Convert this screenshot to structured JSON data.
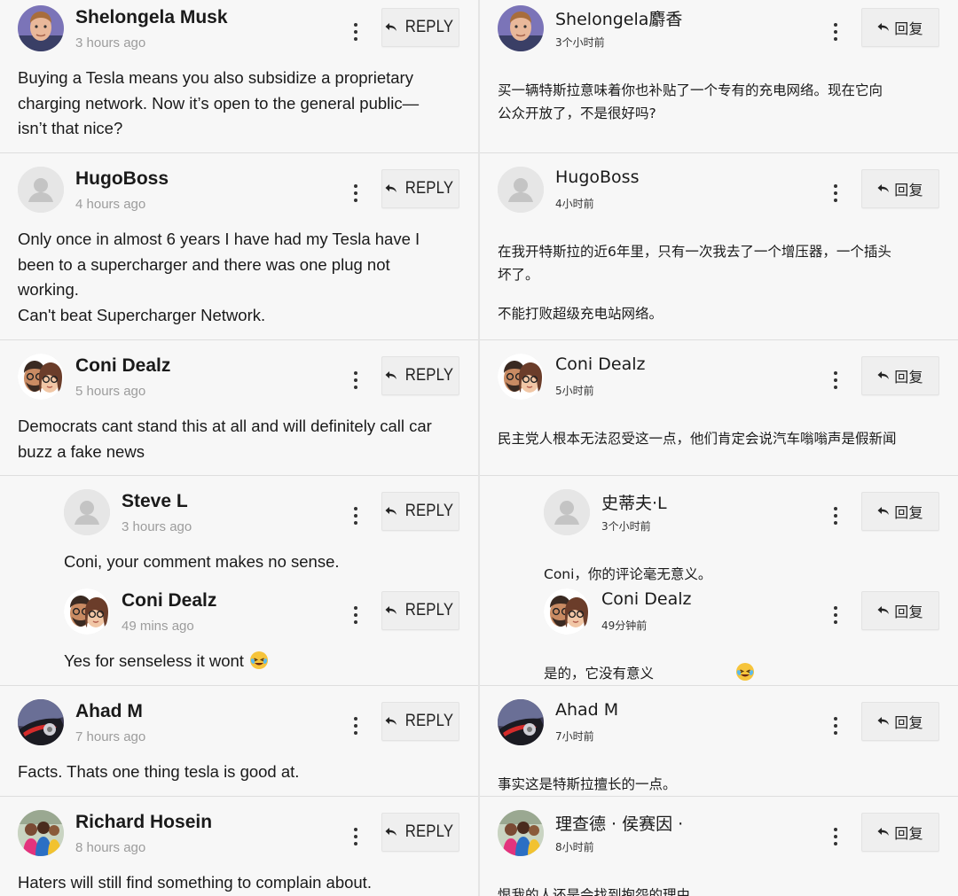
{
  "left": {
    "reply_label": "REPLY",
    "comments": [
      {
        "name": "Shelongela Musk",
        "time": "3 hours ago",
        "lines": [
          "Buying a Tesla means you also subsidize a proprietary",
          "charging network. Now it’s open to the general public—",
          "isn’t that nice?"
        ]
      },
      {
        "name": "HugoBoss",
        "time": "4 hours ago",
        "lines": [
          "Only once in almost 6 years I have had my Tesla have I",
          "been to a supercharger and there was one plug not",
          "working.",
          "Can't beat Supercharger Network."
        ]
      },
      {
        "name": "Coni Dealz",
        "time": "5 hours ago",
        "lines": [
          "Democrats cant stand this at all and will definitely call car",
          "buzz a fake news"
        ]
      },
      {
        "name": "Steve L",
        "time": "3 hours ago",
        "lines": [
          "Coni, your comment makes no sense."
        ]
      },
      {
        "name": "Coni Dealz",
        "time": "49 mins ago",
        "lines": [
          "Yes for senseless it wont"
        ]
      },
      {
        "name": "Ahad M",
        "time": "7 hours ago",
        "lines": [
          "Facts. Thats one thing tesla is good at."
        ]
      },
      {
        "name": "Richard Hosein",
        "time": "8 hours ago",
        "lines": [
          "Haters will still find something to complain about."
        ]
      }
    ]
  },
  "right": {
    "reply_label": "回复",
    "comments": [
      {
        "name": "Shelongela麝香",
        "time": "3个小时前",
        "lines": [
          "买一辆特斯拉意味着你也补贴了一个专有的充电网络。现在它向",
          "公众开放了，不是很好吗?"
        ]
      },
      {
        "name": "HugoBoss",
        "time": "4小时前",
        "lines": [
          "在我开特斯拉的近6年里，只有一次我去了一个增压器，一个插头",
          "坏了。",
          "不能打败超级充电站网络。"
        ]
      },
      {
        "name": "Coni Dealz",
        "time": "5小时前",
        "lines": [
          "民主党人根本无法忍受这一点，他们肯定会说汽车嗡嗡声是假新闻"
        ]
      },
      {
        "name": "史蒂夫·L",
        "time": "3个小时前",
        "lines": [
          "Coni，你的评论毫无意义。"
        ]
      },
      {
        "name": "Coni Dealz",
        "time": "49分钟前",
        "lines": [
          "是的，它没有意义"
        ]
      },
      {
        "name": "Ahad M",
        "time": "7小时前",
        "lines": [
          "事实这是特斯拉擅长的一点。"
        ]
      },
      {
        "name": "理查德 · 侯赛因 ·",
        "time": "8小时前",
        "lines": [
          "恨我的人还是会找到抱怨的理由。"
        ]
      }
    ]
  },
  "icons": {
    "more": "more-vertical-icon",
    "reply": "reply-arrow-icon",
    "emoji": "rolling-on-floor-laughing-emoji"
  }
}
